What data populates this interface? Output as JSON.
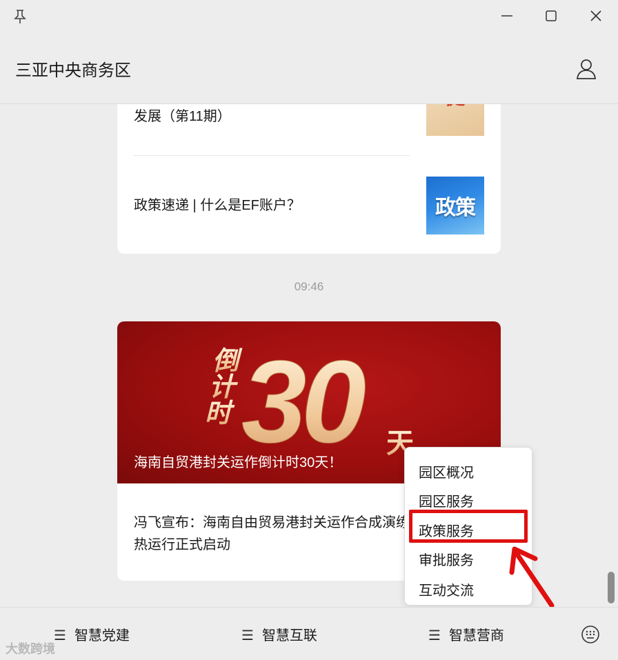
{
  "header": {
    "title": "三亚中央商务区"
  },
  "icons": {
    "pin": "pin-icon",
    "minimize": "minimize-icon",
    "maximize": "maximize-icon",
    "close": "close-icon",
    "user": "user-icon",
    "keyboard": "keyboard-icon",
    "menu_lines": "hamburger-icon"
  },
  "chat": {
    "card1": {
      "items": [
        {
          "title": "发展（第11期）"
        },
        {
          "title": "政策速递 | 什么是EF账户？",
          "thumb_text": "政策"
        }
      ]
    },
    "timestamp": "09:46",
    "card2": {
      "banner_text": {
        "line1": "倒",
        "line2": "计",
        "line3": "时",
        "number": "30",
        "unit": "天"
      },
      "banner_caption": "海南自贸港封关运作倒计时30天！",
      "article_title": "冯飞宣布：海南自由贸易港封关运作合成演练和7x24小时热运行正式启动"
    }
  },
  "popup_menu": {
    "items": [
      "园区概况",
      "园区服务",
      "政策服务",
      "审批服务",
      "互动交流"
    ],
    "highlighted_index": 2
  },
  "bottom_tabs": [
    {
      "label": "智慧党建"
    },
    {
      "label": "智慧互联"
    },
    {
      "label": "智慧营商"
    }
  ],
  "watermark": "大数跨境",
  "colors": {
    "background": "#ededed",
    "banner_red": "#9c0e0e",
    "annotation_red": "#e01010",
    "card": "#ffffff"
  }
}
